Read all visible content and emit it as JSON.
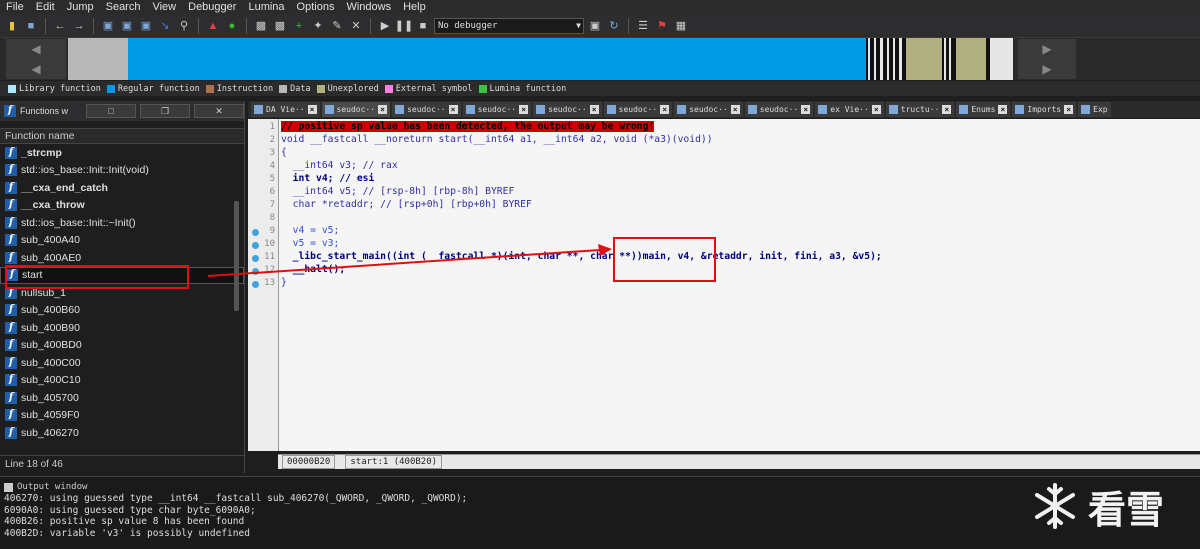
{
  "menu": [
    "File",
    "Edit",
    "Jump",
    "Search",
    "View",
    "Debugger",
    "Lumina",
    "Options",
    "Windows",
    "Help"
  ],
  "toolbar": {
    "debugger_select": "No debugger"
  },
  "legend": [
    {
      "label": "Library function",
      "color": "#aee8ff"
    },
    {
      "label": "Regular function",
      "color": "#0099e6"
    },
    {
      "label": "Instruction",
      "color": "#b07050"
    },
    {
      "label": "Data",
      "color": "#b8b8b8"
    },
    {
      "label": "Unexplored",
      "color": "#b0b080"
    },
    {
      "label": "External symbol",
      "color": "#ff80e0"
    },
    {
      "label": "Lumina function",
      "color": "#40c040"
    }
  ],
  "functions_panel": {
    "title": "Functions w",
    "column_header": "Function name",
    "items": [
      "_strcmp",
      "std::ios_base::Init::Init(void)",
      "__cxa_end_catch",
      "__cxa_throw",
      "std::ios_base::Init::~Init()",
      "sub_400A40",
      "sub_400AE0",
      "start",
      "nullsub_1",
      "sub_400B60",
      "sub_400B90",
      "sub_400BD0",
      "sub_400C00",
      "sub_400C10",
      "sub_405700",
      "sub_4059F0",
      "sub_406270"
    ],
    "status": "Line 18 of 46"
  },
  "tabs": [
    "DA Vie··",
    "seudoc··",
    "seudoc··",
    "seudoc··",
    "seudoc··",
    "seudoc··",
    "seudoc··",
    "seudoc··",
    "ex Vie··",
    "tructu··",
    "Enums",
    "Imports",
    "Exp"
  ],
  "code": {
    "line_numbers": [
      "1",
      "2",
      "3",
      "4",
      "5",
      "6",
      "7",
      "8",
      "9",
      "10",
      "11",
      "12",
      "13"
    ],
    "warning": "// positive sp value has been detected, the output may be wrong!",
    "line2": "void __fastcall __noreturn start(__int64 a1, __int64 a2, void (*a3)(void))",
    "line3": "{",
    "line4": "  __int64 v3; // rax",
    "line5": "  int v4; // esi",
    "line6": "  __int64 v5; // [rsp-8h] [rbp-8h] BYREF",
    "line7": "  char *retaddr; // [rsp+0h] [rbp+0h] BYREF",
    "line8": "",
    "line9": "  v4 = v5;",
    "line10": "  v5 = v3;",
    "line11": "  _libc_start_main((int (__fastcall *)(int, char **, char **))main, v4, &retaddr, init, fini, a3, &v5);",
    "line12": "  __halt();",
    "line13": "}"
  },
  "editor_status": {
    "address": "00000B20",
    "location": "start:1 (400B20)"
  },
  "output": {
    "title": "Output window",
    "lines": [
      "406270: using guessed type __int64 __fastcall sub_406270(_QWORD, _QWORD, _QWORD);",
      "6090A0: using guessed type char byte_6090A0;",
      "400B26: positive sp value 8 has been found",
      "400B2D: variable 'v3' is possibly undefined"
    ]
  },
  "watermark": "看雪"
}
